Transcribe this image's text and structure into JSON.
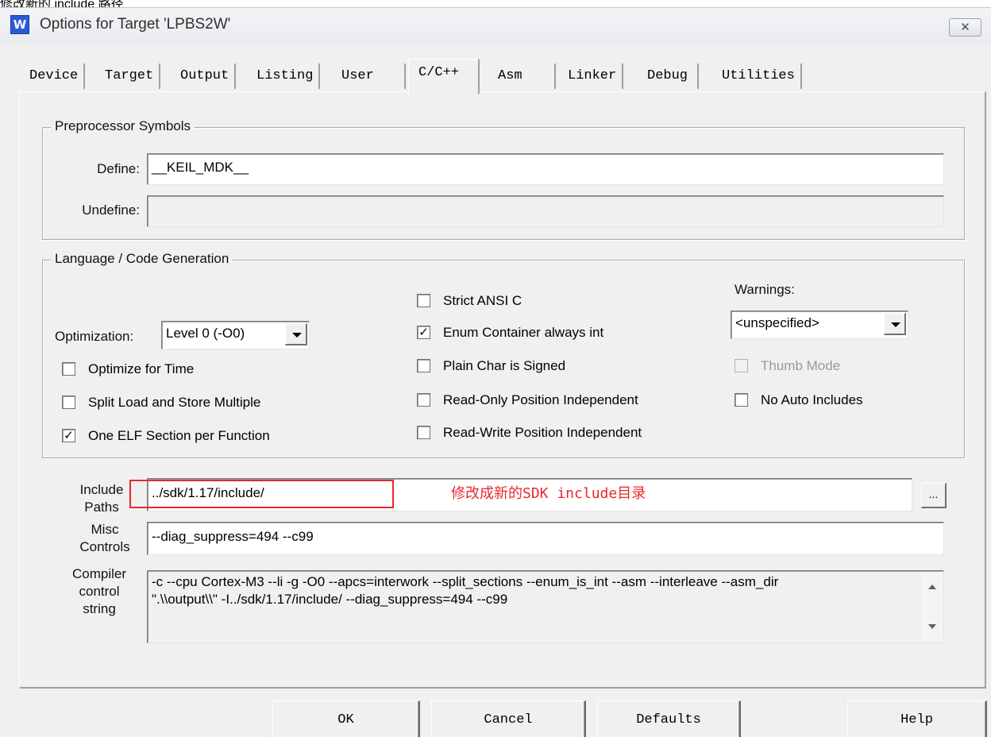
{
  "page_caption": "修改新的 include 路径",
  "window": {
    "title": "Options for Target 'LPBS2W'",
    "icon_glyph": "W",
    "close_glyph": "✕"
  },
  "tabs": [
    {
      "label": "Device",
      "active": false
    },
    {
      "label": "Target",
      "active": false
    },
    {
      "label": "Output",
      "active": false
    },
    {
      "label": "Listing",
      "active": false
    },
    {
      "label": "User",
      "active": false
    },
    {
      "label": "C/C++",
      "active": true
    },
    {
      "label": "Asm",
      "active": false
    },
    {
      "label": "Linker",
      "active": false
    },
    {
      "label": "Debug",
      "active": false
    },
    {
      "label": "Utilities",
      "active": false
    }
  ],
  "preprocessor": {
    "legend": "Preprocessor Symbols",
    "define_label": "Define:",
    "define_value": "__KEIL_MDK__",
    "undefine_label": "Undefine:",
    "undefine_value": ""
  },
  "language": {
    "legend": "Language / Code Generation",
    "optimization_label": "Optimization:",
    "optimization_value": "Level 0 (-O0)",
    "warnings_label": "Warnings:",
    "warnings_value": "<unspecified>",
    "options": {
      "optimize_for_time": {
        "label": "Optimize for Time",
        "checked": false
      },
      "split_load_store": {
        "label": "Split Load and Store Multiple",
        "checked": false
      },
      "one_elf_section": {
        "label": "One ELF Section per Function",
        "checked": true
      },
      "strict_ansi": {
        "label": "Strict ANSI C",
        "checked": false
      },
      "enum_container": {
        "label": "Enum Container always int",
        "checked": true
      },
      "plain_char_signed": {
        "label": "Plain Char is Signed",
        "checked": false
      },
      "ro_position_indep": {
        "label": "Read-Only Position Independent",
        "checked": false
      },
      "rw_position_indep": {
        "label": "Read-Write Position Independent",
        "checked": false
      },
      "thumb_mode": {
        "label": "Thumb Mode",
        "checked": false,
        "disabled": true
      },
      "no_auto_includes": {
        "label": "No Auto Includes",
        "checked": false
      }
    }
  },
  "include_paths": {
    "label_line1": "Include",
    "label_line2": "Paths",
    "value": "../sdk/1.17/include/",
    "browse_label": "..."
  },
  "annotation": {
    "text": "修改成新的SDK include目录",
    "color": "#e8292f"
  },
  "misc_controls": {
    "label_line1": "Misc",
    "label_line2": "Controls",
    "value": "--diag_suppress=494  --c99"
  },
  "compiler_control": {
    "label_line1": "Compiler",
    "label_line2": "control",
    "label_line3": "string",
    "line1": "-c --cpu Cortex-M3 --li -g -O0 --apcs=interwork --split_sections --enum_is_int --asm --interleave --asm_dir",
    "line2": "\".\\\\output\\\\\" -I../sdk/1.17/include/ --diag_suppress=494  --c99"
  },
  "buttons": {
    "ok": "OK",
    "cancel": "Cancel",
    "defaults": "Defaults",
    "help": "Help"
  }
}
